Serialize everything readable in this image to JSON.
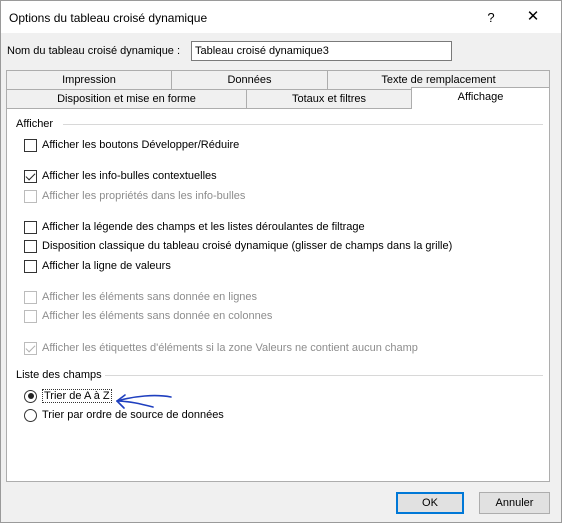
{
  "window": {
    "title": "Options du tableau croisé dynamique",
    "help_glyph": "?",
    "close_glyph": "✕"
  },
  "name_field": {
    "label": "Nom du tableau croisé dynamique :",
    "value": "Tableau croisé dynamique3"
  },
  "tabs": {
    "row_back": [
      {
        "label": "Impression"
      },
      {
        "label": "Données"
      },
      {
        "label": "Texte de remplacement"
      }
    ],
    "row_front": [
      {
        "label": "Disposition et mise en forme"
      },
      {
        "label": "Totaux et filtres"
      },
      {
        "label": "Affichage",
        "active": true
      }
    ]
  },
  "afficher": {
    "title": "Afficher",
    "options": [
      {
        "label": "Afficher les boutons Développer/Réduire",
        "checked": false,
        "enabled": true
      },
      {
        "label": "Afficher les info-bulles contextuelles",
        "checked": true,
        "enabled": true
      },
      {
        "label": "Afficher les propriétés dans les info-bulles",
        "checked": false,
        "enabled": false
      },
      {
        "label": "Afficher la légende des champs et les listes déroulantes de filtrage",
        "checked": false,
        "enabled": true
      },
      {
        "label": "Disposition classique du tableau croisé dynamique (glisser de champs dans la grille)",
        "checked": false,
        "enabled": true
      },
      {
        "label": "Afficher la ligne de valeurs",
        "checked": false,
        "enabled": true
      },
      {
        "label": "Afficher les éléments sans donnée en lignes",
        "checked": false,
        "enabled": false
      },
      {
        "label": "Afficher les éléments sans donnée en colonnes",
        "checked": false,
        "enabled": false
      },
      {
        "label": "Afficher les étiquettes d'éléments si la zone Valeurs ne contient aucun champ",
        "checked": true,
        "enabled": false
      }
    ]
  },
  "liste_champs": {
    "title": "Liste des champs",
    "options": [
      {
        "label": "Trier de A à Z",
        "selected": true
      },
      {
        "label": "Trier par ordre de source de données",
        "selected": false
      }
    ]
  },
  "buttons": {
    "ok": "OK",
    "cancel": "Annuler"
  },
  "colors": {
    "annotation_arrow": "#1f3fbf",
    "default_button_border": "#0078d7"
  }
}
